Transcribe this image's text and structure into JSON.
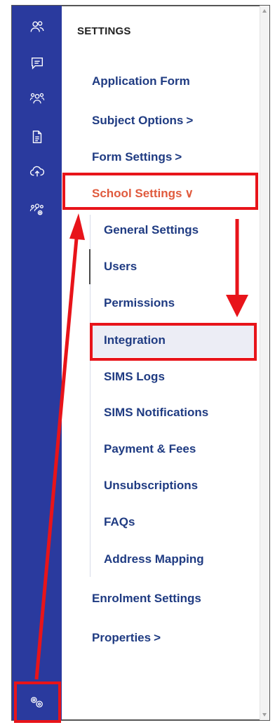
{
  "panel": {
    "title": "SETTINGS"
  },
  "sidebar": {
    "icons": [
      "users-icon",
      "chat-icon",
      "group-icon",
      "document-icon",
      "cloud-upload-icon",
      "team-settings-icon",
      "settings-gear-icon"
    ]
  },
  "menu": {
    "items": [
      {
        "label": "Application Form",
        "chevron": ""
      },
      {
        "label": "Subject Options",
        "chevron": ">"
      },
      {
        "label": "Form Settings",
        "chevron": ">"
      },
      {
        "label": "School Settings",
        "chevron": "∨",
        "active": true
      },
      {
        "label": "Enrolment Settings",
        "chevron": ""
      },
      {
        "label": "Properties",
        "chevron": ">"
      }
    ],
    "school_settings_children": [
      "General Settings",
      "Users",
      "Permissions",
      "Integration",
      "SIMS Logs",
      "SIMS Notifications",
      "Payment & Fees",
      "Unsubscriptions",
      "FAQs",
      "Address Mapping"
    ]
  },
  "colors": {
    "sidebar_bg": "#2a3a9e",
    "menu_text": "#1f3b82",
    "active_text": "#e05a3d",
    "annotation_red": "#e8141a",
    "highlight_bg": "#ecedf5"
  }
}
